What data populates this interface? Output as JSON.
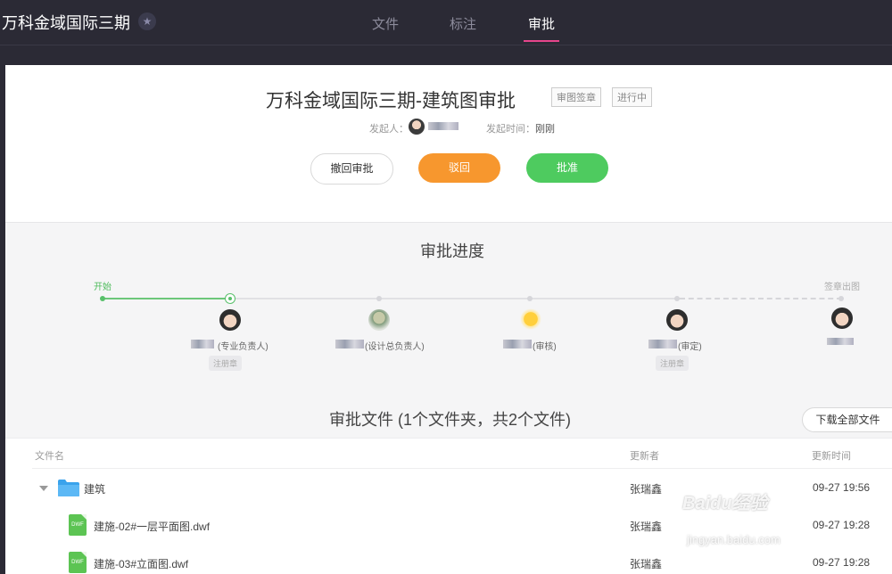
{
  "header": {
    "project_title": "万科金域国际三期",
    "star_icon": "star-icon",
    "tabs": [
      {
        "label": "文件",
        "active": false
      },
      {
        "label": "标注",
        "active": false
      },
      {
        "label": "审批",
        "active": true
      }
    ],
    "accent_color": "#e6458c"
  },
  "approval": {
    "title": "万科金域国际三期-建筑图审批",
    "tags": [
      "审图签章",
      "进行中"
    ],
    "initiator_label": "发起人：",
    "time_label": "发起时间：",
    "time_value": "刚刚",
    "buttons": {
      "withdraw": "撤回审批",
      "reject": "驳回",
      "approve": "批准"
    },
    "colors": {
      "reject": "#f7972e",
      "approve": "#4ecb5f"
    }
  },
  "progress": {
    "title": "审批进度",
    "start_label": "开始",
    "end_label": "签章出图",
    "steps": [
      {
        "role": "(专业负责人)",
        "note": "注册章"
      },
      {
        "role": "(设计总负责人)"
      },
      {
        "role": "(审核)"
      },
      {
        "role": "(审定)",
        "note": "注册章"
      }
    ]
  },
  "files": {
    "title": "审批文件 (1个文件夹，共2个文件)",
    "download_all": "下载全部文件",
    "columns": {
      "name": "文件名",
      "updater": "更新者",
      "updated": "更新时间"
    },
    "rows": [
      {
        "type": "folder",
        "name": "建筑",
        "updater": "张瑞鑫",
        "time": "09-27 19:56"
      },
      {
        "type": "file",
        "icon": "DWF",
        "name": "建施-02#一层平面图.dwf",
        "updater": "张瑞鑫",
        "time": "09-27 19:28"
      },
      {
        "type": "file",
        "icon": "DWF",
        "name": "建施-03#立面图.dwf",
        "updater": "张瑞鑫",
        "time": "09-27 19:28"
      }
    ]
  },
  "watermark": {
    "text": "Baidu经验",
    "sub": "jingyan.baidu.com"
  }
}
